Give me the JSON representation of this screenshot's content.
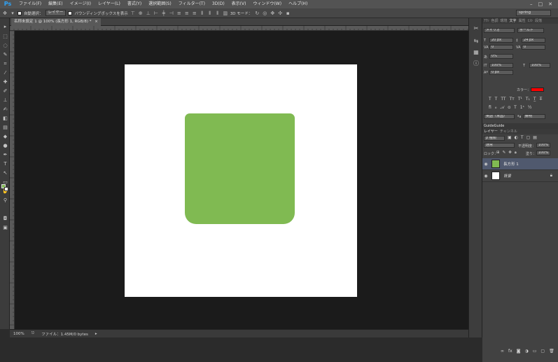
{
  "app": {
    "logo": "Ps"
  },
  "menu": [
    "ファイル(F)",
    "編集(E)",
    "イメージ(I)",
    "レイヤー(L)",
    "書式(Y)",
    "選択範囲(S)",
    "フィルター(T)",
    "3D(D)",
    "表示(V)",
    "ウィンドウ(W)",
    "ヘルプ(H)"
  ],
  "window_buttons": {
    "minimize": "–",
    "maximize": "□",
    "close": "✕"
  },
  "options": {
    "auto_select_label": "自動選択：",
    "auto_select_target": "レイヤー",
    "bounding_box_label": "バウンディングボックスを表示",
    "mode_3d_label": "3D モード：",
    "workspace": "spring"
  },
  "document": {
    "tab_title": "名称未設定 1 @ 100% (長方形 1, RGB/8) *",
    "tab_close": "×",
    "canvas_color": "#ffffff",
    "shape_color": "#80ba52"
  },
  "status": {
    "zoom": "100%",
    "file_info": "ファイル：1.45M/0 bytes"
  },
  "char_panel": {
    "tabs": [
      "ｱｸｼ",
      "色調",
      "環境",
      "文字",
      "属性",
      "ﾋｽﾄ",
      "段落"
    ],
    "active_tab": "文字",
    "font_family": "メイリオ",
    "font_style": "ボールド",
    "font_size": "20 px",
    "leading": "24 px",
    "kerning": "0",
    "tracking": "0",
    "baseline": "0%",
    "vscale": "100%",
    "hscale": "100%",
    "shift": "0 px",
    "color_label": "カラー：",
    "text_color": "#ff0000",
    "lang": "英語（米国）",
    "aa_label": "ªa",
    "aa_mode": "鮮明"
  },
  "guide_panel": {
    "title": "GuideGuide"
  },
  "layers_panel": {
    "tabs": [
      "レイヤー",
      "チャンネル"
    ],
    "kind_filter": "ρ 種類",
    "blend_mode": "通常",
    "opacity_label": "不透明度：",
    "opacity": "100%",
    "lock_label": "ロック：",
    "fill_label": "塗り：",
    "fill": "100%",
    "layers": [
      {
        "name": "長方形 1",
        "thumb_color": "#80ba52",
        "selected": true
      },
      {
        "name": "背景",
        "thumb_color": "#ffffff",
        "selected": false
      }
    ]
  }
}
